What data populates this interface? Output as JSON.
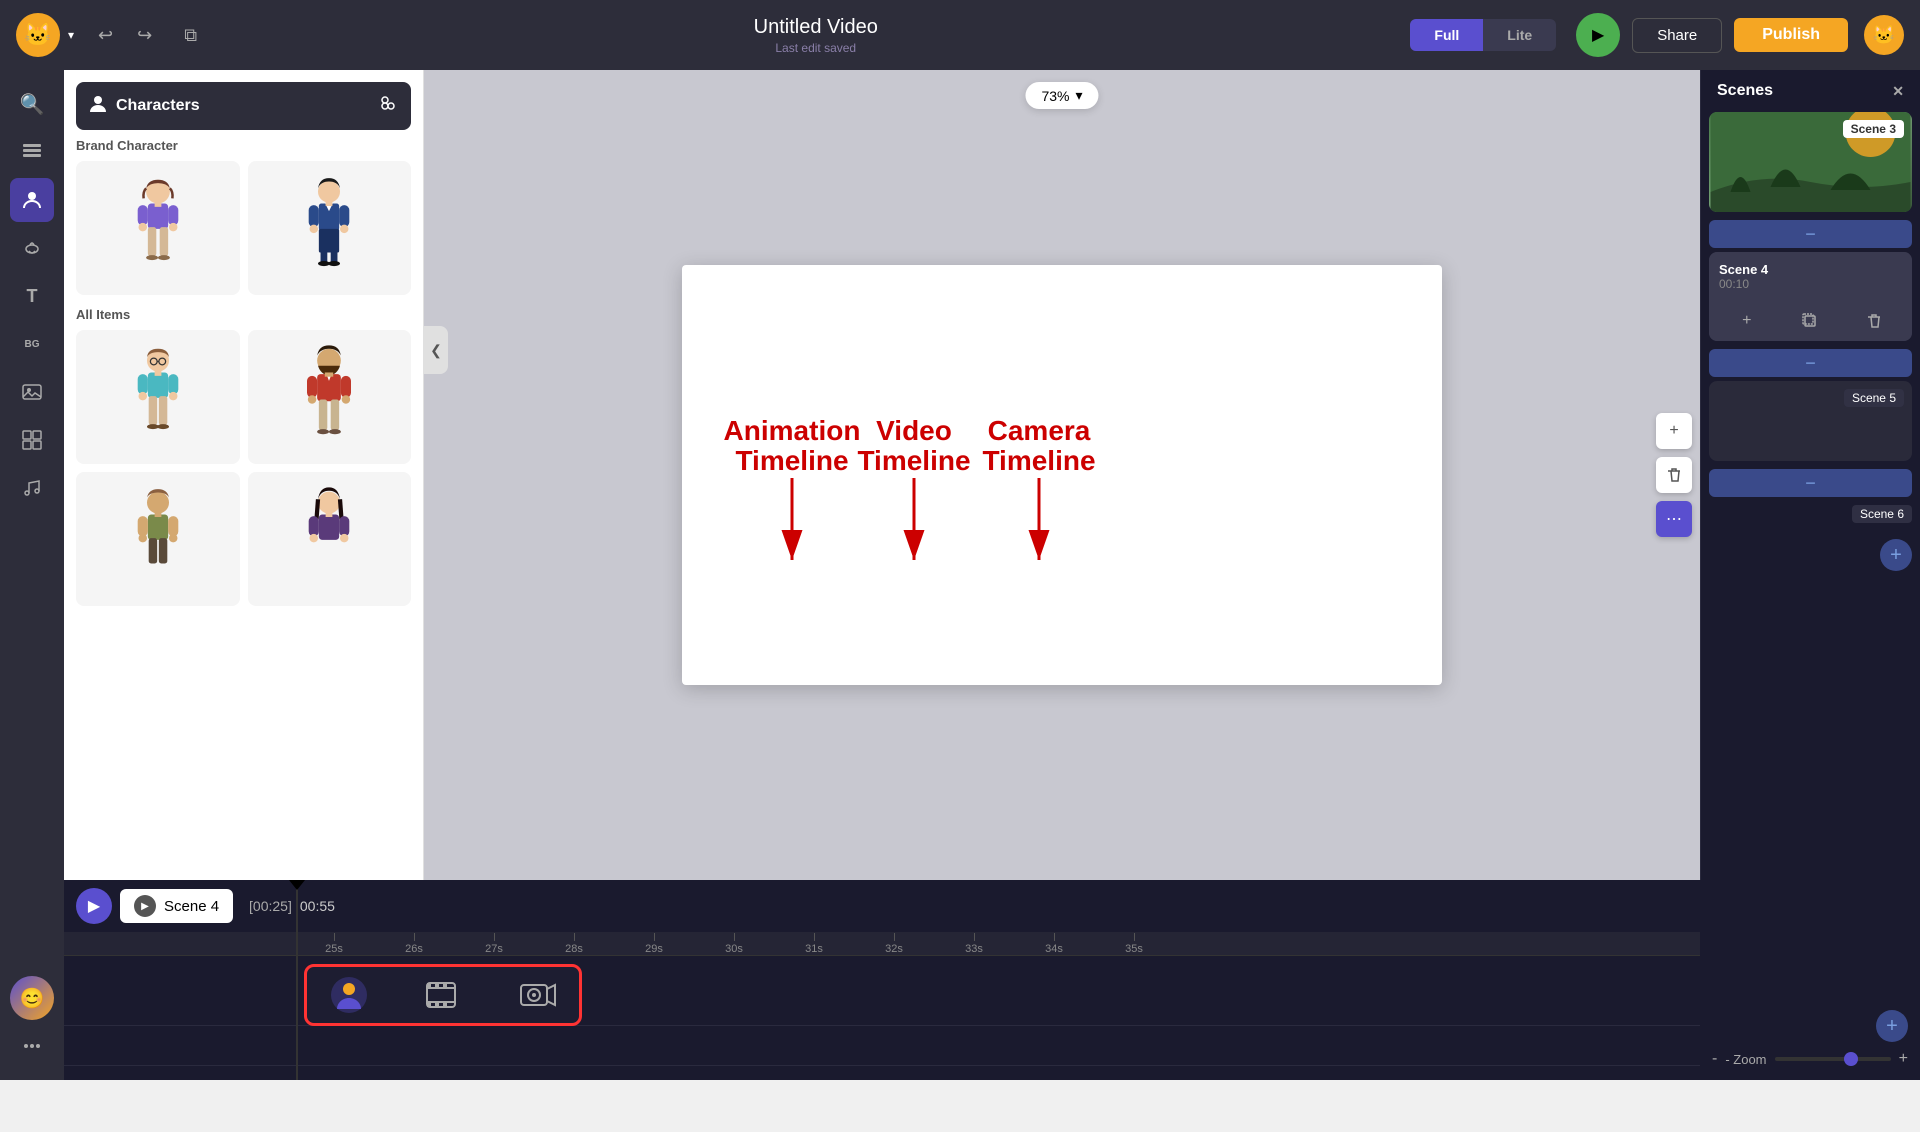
{
  "header": {
    "title": "Untitled Video",
    "subtitle": "Last edit saved",
    "undo_label": "↩",
    "redo_label": "↪",
    "copy_label": "⧉",
    "full_label": "Full",
    "lite_label": "Lite",
    "share_label": "Share",
    "publish_label": "Publish",
    "zoom_value": "73%"
  },
  "left_toolbar": {
    "icons": [
      {
        "name": "search",
        "symbol": "🔍",
        "active": false
      },
      {
        "name": "layers",
        "symbol": "⬛",
        "active": false
      },
      {
        "name": "character",
        "symbol": "👤",
        "active": true
      },
      {
        "name": "props",
        "symbol": "☕",
        "active": false
      },
      {
        "name": "text",
        "symbol": "T",
        "active": false
      },
      {
        "name": "background",
        "symbol": "BG",
        "active": false
      },
      {
        "name": "image",
        "symbol": "🖼",
        "active": false
      },
      {
        "name": "chart",
        "symbol": "⊞",
        "active": false
      },
      {
        "name": "music",
        "symbol": "♪",
        "active": false
      },
      {
        "name": "more",
        "symbol": "+",
        "active": false
      }
    ]
  },
  "characters_panel": {
    "title": "Characters",
    "section_brand": "Brand Character",
    "section_all": "All Items",
    "brand_characters": [
      {
        "id": 1,
        "description": "Female character with purple top"
      },
      {
        "id": 2,
        "description": "Female character in blue suit"
      }
    ],
    "all_characters": [
      {
        "id": 3,
        "description": "Female character with glasses"
      },
      {
        "id": 4,
        "description": "Male character with beard"
      },
      {
        "id": 5,
        "description": "Male character casual"
      },
      {
        "id": 6,
        "description": "Female character dark hair"
      }
    ]
  },
  "scenes_panel": {
    "title": "Scenes",
    "scene3_label": "Scene 3",
    "scene4_label": "Scene 4",
    "scene4_time": "00:10",
    "scene5_label": "Scene 5",
    "scene6_label": "Scene 6"
  },
  "timeline": {
    "scene_label": "Scene 4",
    "time_start": "[00:25]",
    "time_end": "00:55",
    "ruler_ticks": [
      "25s",
      "26s",
      "27s",
      "28s",
      "29s",
      "30s",
      "31s",
      "32s",
      "33s",
      "34s",
      "35s"
    ],
    "animation_label": "Animation\nTimeline",
    "video_label": "Video\nTimeline",
    "camera_label": "Camera\nTimeline"
  },
  "annotation": {
    "animation_title": "Animation",
    "animation_sub": "Timeline",
    "video_title": "Video",
    "video_sub": "Timeline",
    "camera_title": "Camera",
    "camera_sub": "Timeline"
  },
  "zoom": {
    "label": "- Zoom",
    "value": "73%"
  }
}
